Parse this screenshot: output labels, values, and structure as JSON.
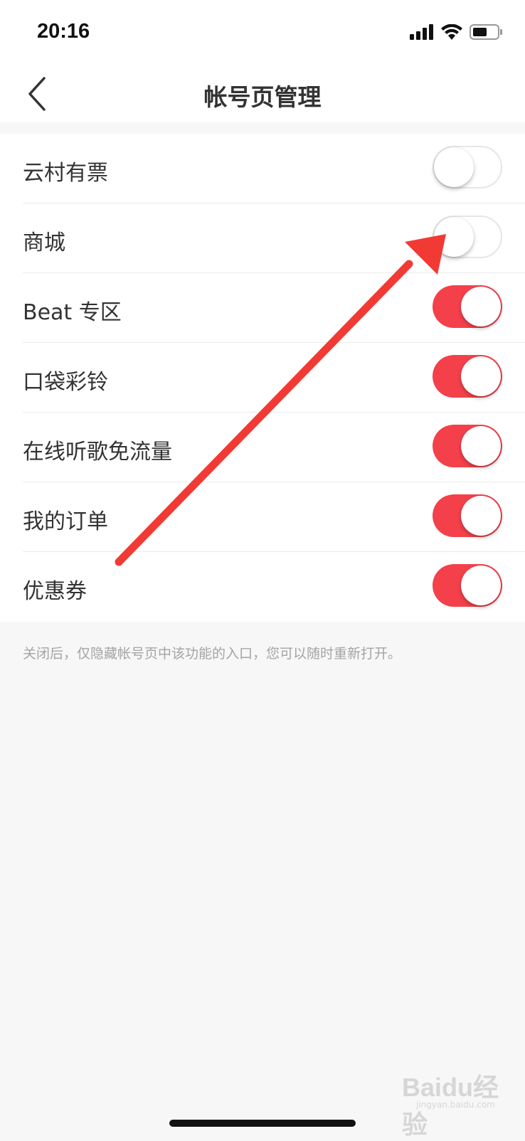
{
  "status_bar": {
    "time": "20:16",
    "icons": [
      "signal-icon",
      "wifi-icon",
      "battery-icon"
    ]
  },
  "header": {
    "title": "帐号页管理",
    "back_icon": "chevron-left-icon"
  },
  "settings": [
    {
      "label": "云村有票",
      "enabled": false
    },
    {
      "label": "商城",
      "enabled": false
    },
    {
      "label": "Beat 专区",
      "enabled": true
    },
    {
      "label": "口袋彩铃",
      "enabled": true
    },
    {
      "label": "在线听歌免流量",
      "enabled": true
    },
    {
      "label": "我的订单",
      "enabled": true
    },
    {
      "label": "优惠券",
      "enabled": true
    }
  ],
  "footnote": "关闭后，仅隐藏帐号页中该功能的入口，您可以随时重新打开。",
  "watermark": {
    "text": "Baidu经验",
    "sub": "jingyan.baidu.com"
  },
  "colors": {
    "accent": "#f4404a",
    "annotation_arrow": "#f23a34",
    "background": "#f7f7f7"
  }
}
